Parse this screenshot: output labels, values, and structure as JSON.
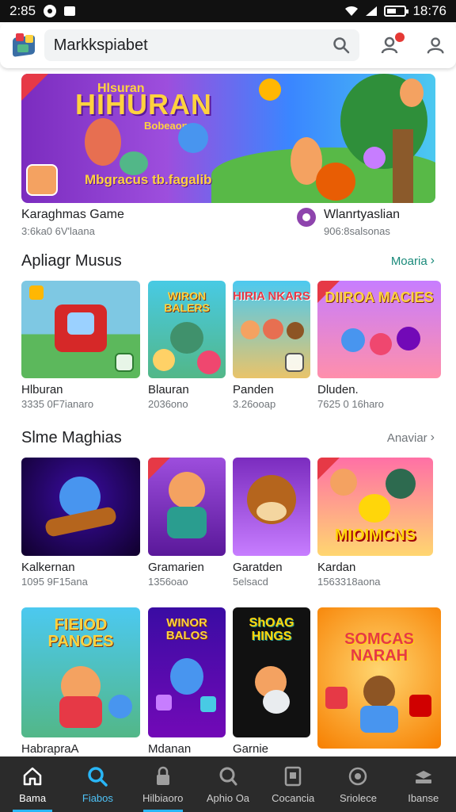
{
  "status": {
    "time": "2:85",
    "right_time": "18:76"
  },
  "app_bar": {
    "search_text": "Markkspiabet"
  },
  "banner": {
    "title": "HIHURAN",
    "small_text": "Hlsuran",
    "sub": "Bobeaon",
    "tagline": "Mbgracus tb.fagalib"
  },
  "featured": {
    "left_title": "Karaghmas Game",
    "left_meta": "3:6ka0 6V'laana",
    "right_title": "Wlanrtyaslian",
    "right_meta": "906:8salsonas"
  },
  "section1": {
    "title": "Apliagr Musus",
    "more": "Moaria",
    "cards": [
      {
        "title": "Hlburan",
        "meta": "3335 0F7ianaro",
        "art": ""
      },
      {
        "title": "Blauran",
        "meta": "2036ono",
        "art": "WIRON BALERS"
      },
      {
        "title": "Panden",
        "meta": "3.26ooap",
        "art": "HIRIA NKARS"
      },
      {
        "title": "Dluden.",
        "meta": "7625 0 16haro",
        "art": "DIIROA MACIES"
      }
    ]
  },
  "section2": {
    "title": "Slme Maghias",
    "more": "Anaviar",
    "cards": [
      {
        "title": "Kalkernan",
        "meta": "1095 9F15ana",
        "art": ""
      },
      {
        "title": "Gramarien",
        "meta": "1356oao",
        "art": ""
      },
      {
        "title": "Garatden",
        "meta": "5elsacd",
        "art": ""
      },
      {
        "title": "Kardan",
        "meta": "1563318aona",
        "art": "MIOIMCNS"
      }
    ]
  },
  "section3": {
    "cards": [
      {
        "title": "HabrapraA",
        "art": "FIEIOD PANOES"
      },
      {
        "title": "Mdanan",
        "art": "WINOR BALOS"
      },
      {
        "title": "Garnie",
        "art": "ShOAG HINGS"
      },
      {
        "title": "",
        "art": "SOMCAS NARAH"
      }
    ]
  },
  "nav": [
    {
      "label": "Bama",
      "icon": "home-icon"
    },
    {
      "label": "Fiabos",
      "icon": "search-icon"
    },
    {
      "label": "Hilbiaoro",
      "icon": "lock-icon"
    },
    {
      "label": "Aphio Oa",
      "icon": "magnifier-icon"
    },
    {
      "label": "Cocancia",
      "icon": "tablet-icon"
    },
    {
      "label": "Sriolece",
      "icon": "target-icon"
    },
    {
      "label": "Ibanse",
      "icon": "stack-icon"
    }
  ],
  "colors": {
    "accent": "#1a8a7a",
    "nav_bg": "#2b2b2b",
    "nav_active": "#29b6f6"
  }
}
